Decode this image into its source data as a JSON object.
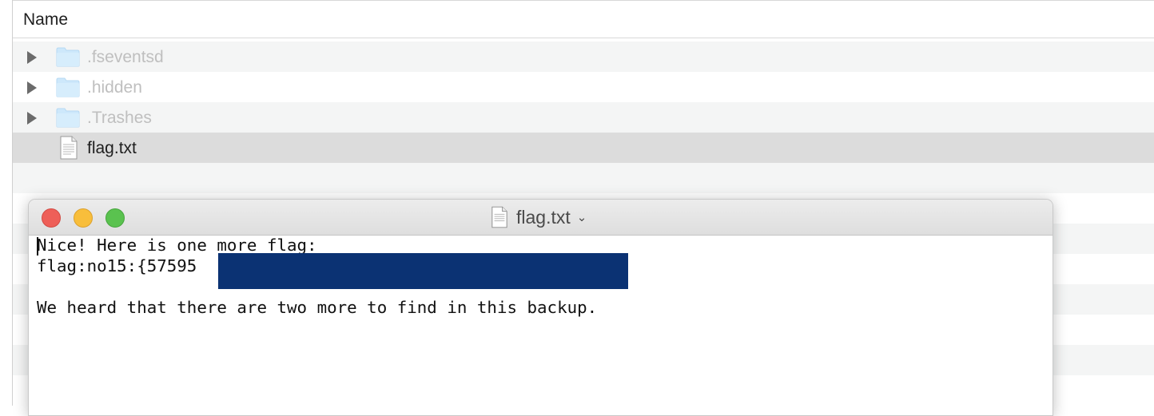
{
  "finder": {
    "column_header": "Name",
    "rows": [
      {
        "name": ".fseventsd",
        "type": "folder"
      },
      {
        "name": ".hidden",
        "type": "folder"
      },
      {
        "name": ".Trashes",
        "type": "folder"
      },
      {
        "name": "flag.txt",
        "type": "file",
        "selected": true
      }
    ]
  },
  "window": {
    "title": "flag.txt",
    "lines": [
      "Nice! Here is one more flag:",
      "flag:no15:{57595",
      "",
      "We heard that there are two more to find in this backup."
    ]
  },
  "colors": {
    "redaction": "#0b3273",
    "selection_row": "#dcdcdc",
    "close": "#ee5f58",
    "minimize": "#f8be3b",
    "zoom": "#5ac24f"
  }
}
